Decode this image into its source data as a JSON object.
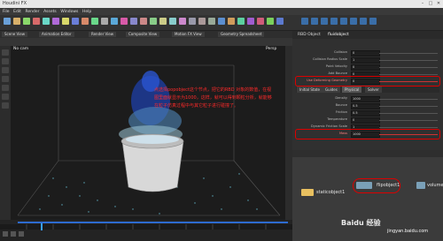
{
  "window": {
    "title": "Houdini FX"
  },
  "menubar": [
    "File",
    "Edit",
    "Render",
    "Assets",
    "Windows",
    "Help"
  ],
  "tabs": [
    "Scene View",
    "Animation Editor",
    "Render View",
    "Composite View",
    "Motion FX View",
    "Geometry Spreadsheet"
  ],
  "viewport": {
    "label": "Persp",
    "camera": "No cam"
  },
  "annotation": "点选择popobject这个节点，把它的RBD 对象的数值，在视图里面就显示为1000，这样，就可以得到颗粒分析，就能够在粒子仿真过程中与其它粒子进行碰撞了。",
  "right_panel": {
    "header": "RBD Object",
    "node_name": "fluidobject",
    "rows_top": [
      {
        "label": "Collision",
        "value": "0"
      },
      {
        "label": "Collision Radius Scale",
        "value": "1"
      },
      {
        "label": "Point Velocity",
        "value": "0"
      },
      {
        "label": "Add Bounce",
        "value": "0"
      },
      {
        "label": "Use Deforming Geometry",
        "value": "0"
      }
    ],
    "tabs": [
      "Initial State",
      "Guides",
      "Physical",
      "Solver"
    ],
    "rows_bottom": [
      {
        "label": "Density",
        "value": "1000"
      },
      {
        "label": "Bounce",
        "value": "0.5"
      },
      {
        "label": "Friction",
        "value": "0.5"
      },
      {
        "label": "Temperature",
        "value": "0"
      },
      {
        "label": "Dynamic Friction Scale",
        "value": "1"
      },
      {
        "label": "Mass",
        "value": "1000"
      }
    ]
  },
  "nodes": [
    {
      "label": "staticobject1"
    },
    {
      "label": "flipobject1"
    },
    {
      "label": "volumes"
    }
  ],
  "watermark": {
    "brand": "Baidu 经验",
    "url": "jingyan.baidu.com"
  }
}
